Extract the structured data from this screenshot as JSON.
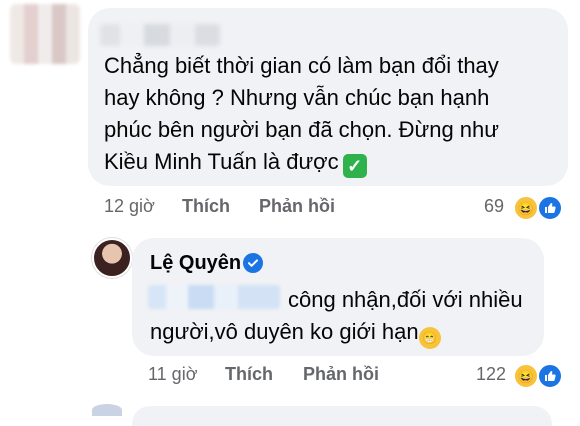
{
  "comment1": {
    "text_lines": [
      "Chẳng biết thời gian có làm bạn đổi thay",
      "hay không ? Nhưng vẫn chúc bạn hạnh",
      "phúc bên người bạn đã chọn. Đừng như",
      "Kiều Minh Tuấn là được"
    ],
    "time": "12 giờ",
    "like_label": "Thích",
    "reply_label": "Phản hồi",
    "reaction_count": "69"
  },
  "comment2": {
    "author": "Lệ Quyên",
    "line1": "công nhận,đối với nhiều",
    "line2": "người,vô duyên ko giới hạn",
    "time": "11 giờ",
    "like_label": "Thích",
    "reply_label": "Phản hồi",
    "reaction_count": "122"
  },
  "icons": [
    "haha-reaction-icon",
    "like-reaction-icon",
    "verified-badge-icon",
    "check-mark-emoji",
    "grinning-emoji"
  ],
  "colors": {
    "bubble": "#f0f2f5",
    "meta": "#65676b",
    "facebook_blue": "#1b74e4",
    "haha_yellow": "#f7c33b",
    "check_green": "#2fb24c"
  }
}
